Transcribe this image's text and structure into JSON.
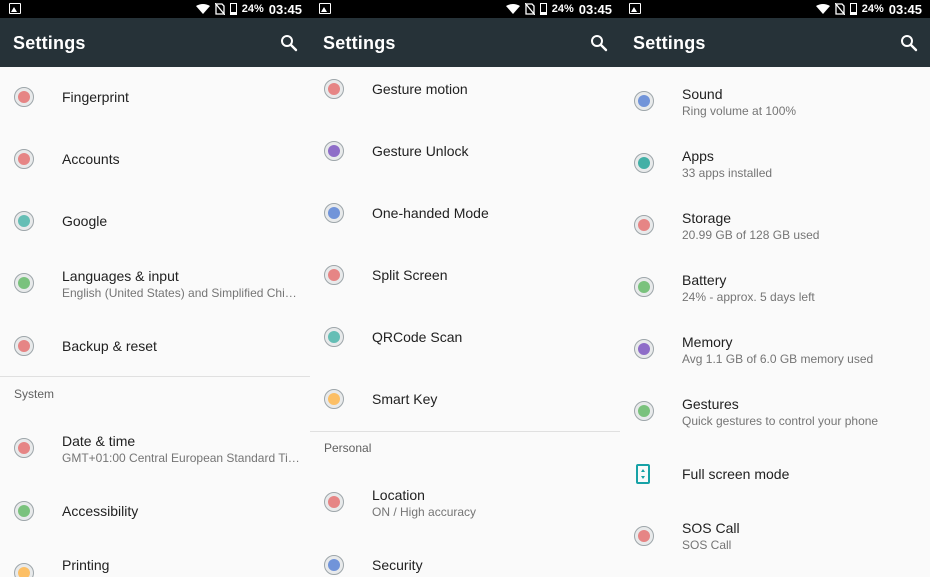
{
  "status_bar": {
    "battery": "24%",
    "time": "03:45"
  },
  "app_bar": {
    "title": "Settings"
  },
  "panel1": {
    "items": [
      {
        "label": "Fingerprint",
        "color": "#e57373"
      },
      {
        "label": "Accounts",
        "color": "#e57373"
      },
      {
        "label": "Google",
        "color": "#4db6ac"
      },
      {
        "label": "Languages & input",
        "sub": "English (United States) and Simplified Chi…",
        "color": "#66bb6a"
      },
      {
        "label": "Backup & reset",
        "color": "#e57373"
      }
    ],
    "section": "System",
    "system_items": [
      {
        "label": "Date & time",
        "sub": "GMT+01:00 Central European Standard Ti…",
        "color": "#e57373"
      },
      {
        "label": "Accessibility",
        "color": "#66bb6a"
      },
      {
        "label": "Printing",
        "color": "#ffb74d"
      }
    ]
  },
  "panel2": {
    "items": [
      {
        "label": "Gesture motion",
        "color": "#e57373"
      },
      {
        "label": "Gesture Unlock",
        "color": "#7e57c2"
      },
      {
        "label": "One-handed Mode",
        "color": "#5c85d6"
      },
      {
        "label": "Split Screen",
        "color": "#e57373"
      },
      {
        "label": "QRCode Scan",
        "color": "#4db6ac"
      },
      {
        "label": "Smart Key",
        "color": "#ffb74d"
      }
    ],
    "section": "Personal",
    "personal_items": [
      {
        "label": "Location",
        "sub": "ON / High accuracy",
        "color": "#e57373"
      },
      {
        "label": "Security",
        "color": "#5c85d6"
      }
    ]
  },
  "panel3": {
    "items": [
      {
        "label": "Sound",
        "sub": "Ring volume at 100%",
        "color": "#5c85d6"
      },
      {
        "label": "Apps",
        "sub": "33 apps installed",
        "color": "#26a69a"
      },
      {
        "label": "Storage",
        "sub": "20.99 GB of 128 GB used",
        "color": "#e57373"
      },
      {
        "label": "Battery",
        "sub": "24% - approx. 5 days left",
        "color": "#66bb6a"
      },
      {
        "label": "Memory",
        "sub": "Avg 1.1 GB of 6.0 GB memory used",
        "color": "#7e57c2"
      },
      {
        "label": "Gestures",
        "sub": "Quick gestures to control your phone",
        "color": "#66bb6a"
      },
      {
        "label": "Full screen mode",
        "icon": "phone-fullscreen-icon"
      },
      {
        "label": "SOS Call",
        "sub": "SOS Call",
        "color": "#e57373"
      }
    ]
  }
}
